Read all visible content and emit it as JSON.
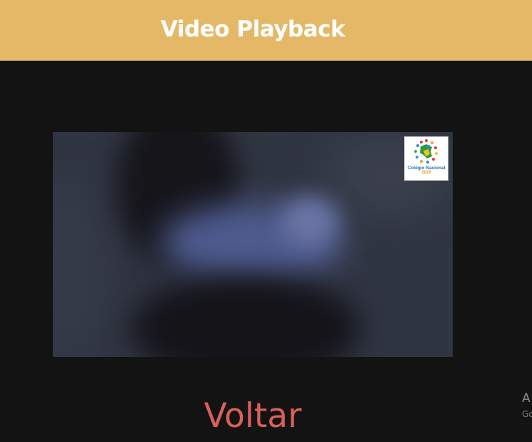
{
  "header": {
    "title": "Video Playback",
    "background_color": "#e4b866"
  },
  "video": {
    "overlay_logo": {
      "line1": "Colégio Nacional",
      "line2": "2020"
    }
  },
  "actions": {
    "back_label": "Voltar",
    "back_color": "#d9605b"
  },
  "edge_text": {
    "line1": "A",
    "line2": "Gc"
  }
}
